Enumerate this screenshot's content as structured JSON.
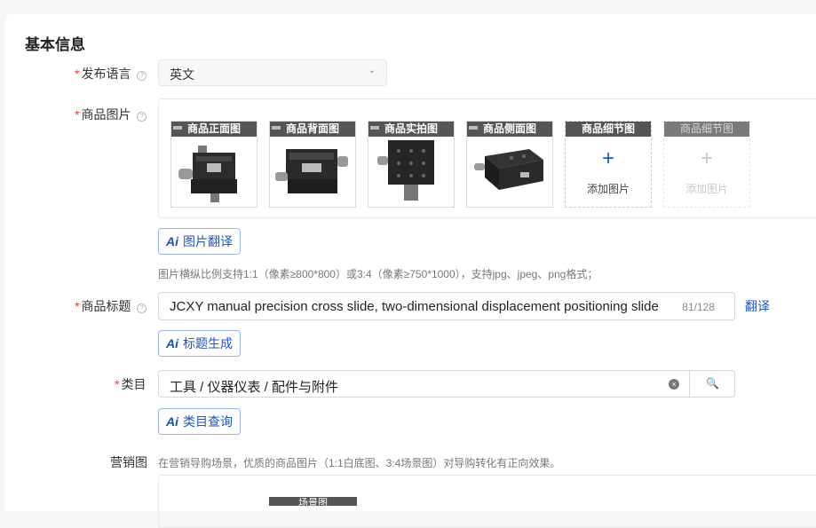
{
  "section": {
    "title": "基本信息"
  },
  "language": {
    "label": "发布语言",
    "value": "英文",
    "help": "?"
  },
  "images": {
    "label": "商品图片",
    "help": "?",
    "thumbs": [
      {
        "caption": "商品正面图"
      },
      {
        "caption": "商品背面图"
      },
      {
        "caption": "商品实拍图"
      },
      {
        "caption": "商品侧面图"
      }
    ],
    "add_slots": [
      {
        "caption": "商品细节图",
        "text": "添加图片",
        "plus": "+"
      },
      {
        "caption": "商品细节图",
        "text": "添加图片",
        "plus": "+"
      }
    ],
    "ai_button": "图片翻译",
    "hint": "图片横纵比例支持1:1（像素≥800*800）或3:4（像素≥750*1000），支持jpg、jpeg、png格式；"
  },
  "title_field": {
    "label": "商品标题",
    "value": "JCXY manual precision cross slide, two-dimensional displacement positioning slide",
    "counter": "81/128",
    "translate_link": "翻译",
    "ai_button": "标题生成"
  },
  "category": {
    "label": "类目",
    "value": "工具 / 仪器仪表 / 配件与附件",
    "ai_button": "类目查询",
    "clear": "×",
    "search": "🔍"
  },
  "marketing": {
    "label": "营销图",
    "hint": "在营销导购场景，优质的商品图片（1:1白底图、3:4场景图）对导购转化有正向效果。",
    "partial_caption": "场景图"
  },
  "ai_mark": "Ai",
  "colors": {
    "accent": "#1a56c9",
    "required": "#e53935",
    "caption_bg": "#555555"
  }
}
